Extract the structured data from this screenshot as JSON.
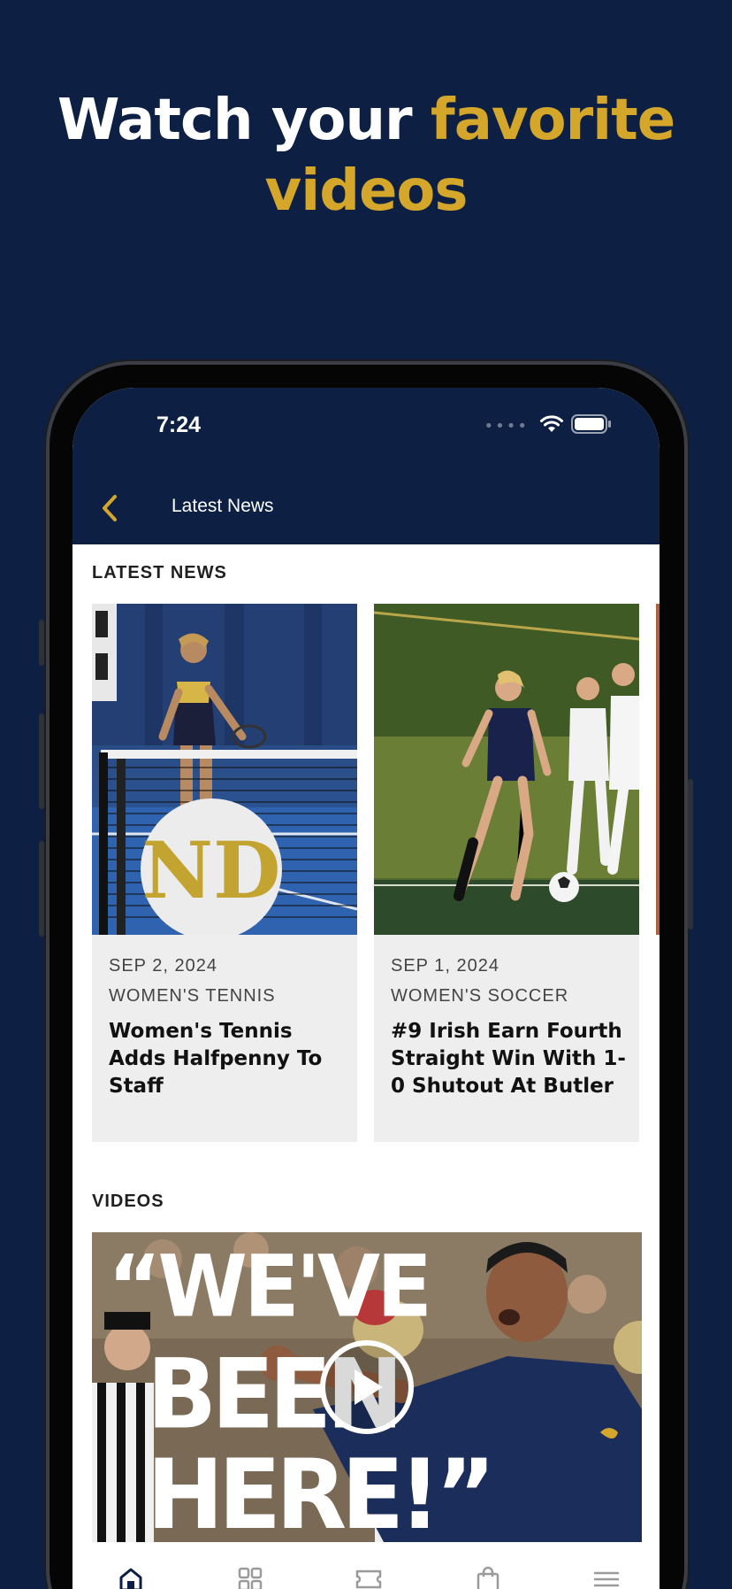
{
  "promo": {
    "headline_part1": "Watch your ",
    "headline_accent": "favorite",
    "headline_line2": "videos"
  },
  "status_bar": {
    "time": "7:24",
    "icons": [
      "signal-dots-icon",
      "wifi-icon",
      "battery-icon"
    ]
  },
  "nav": {
    "back_icon": "chevron-left-icon",
    "title": "Latest News"
  },
  "latest_news": {
    "section_title": "LATEST NEWS",
    "cards": [
      {
        "date": "SEP 2, 2024",
        "category": "WOMEN'S TENNIS",
        "title": "Women's Tennis Adds Halfpenny To Staff",
        "image": "tennis-player-net-photo"
      },
      {
        "date": "SEP 1, 2024",
        "category": "WOMEN'S SOCCER",
        "title": "#9 Irish Earn Fourth Straight Win With 1-0 Shutout At Butler",
        "image": "soccer-match-photo"
      }
    ]
  },
  "videos": {
    "section_title": "VIDEOS",
    "featured": {
      "overlay_text": "“WE'VE BEEN HERE!”",
      "play_icon": "play-icon"
    }
  },
  "tab_bar": {
    "items": [
      "home-icon",
      "grid-icon",
      "ticket-icon",
      "shopping-bag-icon",
      "menu-icon"
    ]
  },
  "colors": {
    "navy": "#0d2044",
    "gold": "#d4a62a",
    "card_bg": "#eeeeee"
  }
}
